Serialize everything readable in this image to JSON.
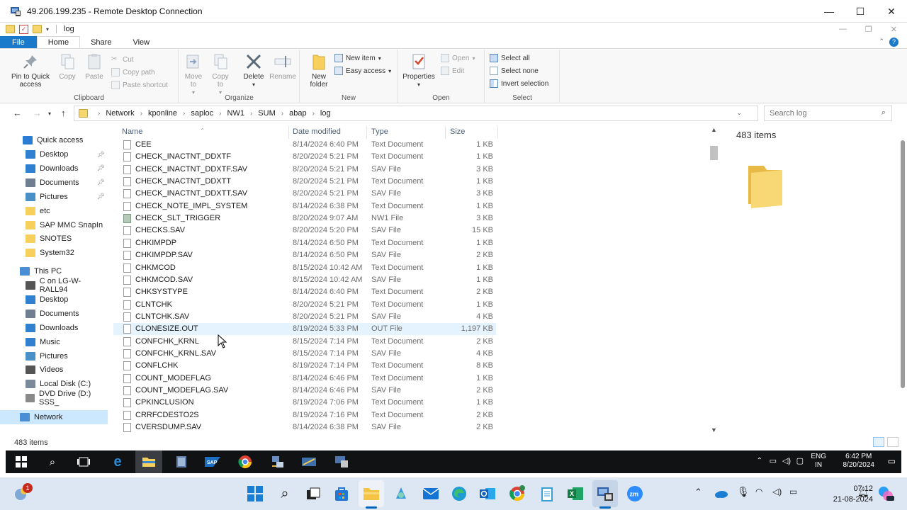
{
  "window": {
    "title": "49.206.199.235 - Remote Desktop Connection",
    "minimize": "—",
    "maximize": "☐",
    "close": "✕"
  },
  "explorer": {
    "title": "log",
    "tabs": [
      {
        "label": "File"
      },
      {
        "label": "Home"
      },
      {
        "label": "Share"
      },
      {
        "label": "View"
      }
    ],
    "help": "?"
  },
  "ribbon": {
    "clipboard": {
      "pin_label": "Pin to Quick access",
      "copy_label": "Copy",
      "paste_label": "Paste",
      "cut_label": "Cut",
      "copy_path_label": "Copy path",
      "paste_shortcut_label": "Paste shortcut",
      "group_label": "Clipboard"
    },
    "organize": {
      "move_to_label": "Move to",
      "copy_to_label": "Copy to",
      "delete_label": "Delete",
      "rename_label": "Rename",
      "group_label": "Organize"
    },
    "new": {
      "new_folder_label": "New folder",
      "new_item_label": "New item",
      "easy_access_label": "Easy access",
      "group_label": "New"
    },
    "open": {
      "properties_label": "Properties",
      "open_label": "Open",
      "edit_label": "Edit",
      "group_label": "Open"
    },
    "select": {
      "select_all_label": "Select all",
      "select_none_label": "Select none",
      "invert_label": "Invert selection",
      "group_label": "Select"
    }
  },
  "address": {
    "crumbs": [
      "Network",
      "kponline",
      "saploc",
      "NW1",
      "SUM",
      "abap",
      "log"
    ],
    "search_placeholder": "Search log"
  },
  "nav": {
    "quick_access": "Quick access",
    "qa_items": [
      "Desktop",
      "Downloads",
      "Documents",
      "Pictures",
      "etc",
      "SAP MMC SnapIn",
      "SNOTES",
      "System32"
    ],
    "this_pc": "This PC",
    "pc_items": [
      "C on LG-W-RALL94",
      "Desktop",
      "Documents",
      "Downloads",
      "Music",
      "Pictures",
      "Videos",
      "Local Disk (C:)",
      "DVD Drive (D:) SSS_"
    ],
    "network": "Network"
  },
  "columns": {
    "name": "Name",
    "date": "Date modified",
    "type": "Type",
    "size": "Size"
  },
  "files": [
    {
      "name": "CEE",
      "date": "8/14/2024 6:40 PM",
      "type": "Text Document",
      "size": "1 KB"
    },
    {
      "name": "CHECK_INACTNT_DDXTF",
      "date": "8/20/2024 5:21 PM",
      "type": "Text Document",
      "size": "1 KB"
    },
    {
      "name": "CHECK_INACTNT_DDXTF.SAV",
      "date": "8/20/2024 5:21 PM",
      "type": "SAV File",
      "size": "3 KB"
    },
    {
      "name": "CHECK_INACTNT_DDXTT",
      "date": "8/20/2024 5:21 PM",
      "type": "Text Document",
      "size": "1 KB"
    },
    {
      "name": "CHECK_INACTNT_DDXTT.SAV",
      "date": "8/20/2024 5:21 PM",
      "type": "SAV File",
      "size": "3 KB"
    },
    {
      "name": "CHECK_NOTE_IMPL_SYSTEM",
      "date": "8/14/2024 6:38 PM",
      "type": "Text Document",
      "size": "1 KB"
    },
    {
      "name": "CHECK_SLT_TRIGGER",
      "date": "8/20/2024 9:07 AM",
      "type": "NW1 File",
      "size": "3 KB"
    },
    {
      "name": "CHECKS.SAV",
      "date": "8/20/2024 5:20 PM",
      "type": "SAV File",
      "size": "15 KB"
    },
    {
      "name": "CHKIMPDP",
      "date": "8/14/2024 6:50 PM",
      "type": "Text Document",
      "size": "1 KB"
    },
    {
      "name": "CHKIMPDP.SAV",
      "date": "8/14/2024 6:50 PM",
      "type": "SAV File",
      "size": "2 KB"
    },
    {
      "name": "CHKMCOD",
      "date": "8/15/2024 10:42 AM",
      "type": "Text Document",
      "size": "1 KB"
    },
    {
      "name": "CHKMCOD.SAV",
      "date": "8/15/2024 10:42 AM",
      "type": "SAV File",
      "size": "1 KB"
    },
    {
      "name": "CHKSYSTYPE",
      "date": "8/14/2024 6:40 PM",
      "type": "Text Document",
      "size": "2 KB"
    },
    {
      "name": "CLNTCHK",
      "date": "8/20/2024 5:21 PM",
      "type": "Text Document",
      "size": "1 KB"
    },
    {
      "name": "CLNTCHK.SAV",
      "date": "8/20/2024 5:21 PM",
      "type": "SAV File",
      "size": "4 KB"
    },
    {
      "name": "CLONESIZE.OUT",
      "date": "8/19/2024 5:33 PM",
      "type": "OUT File",
      "size": "1,197 KB"
    },
    {
      "name": "CONFCHK_KRNL",
      "date": "8/15/2024 7:14 PM",
      "type": "Text Document",
      "size": "2 KB"
    },
    {
      "name": "CONFCHK_KRNL.SAV",
      "date": "8/15/2024 7:14 PM",
      "type": "SAV File",
      "size": "4 KB"
    },
    {
      "name": "CONFLCHK",
      "date": "8/19/2024 7:14 PM",
      "type": "Text Document",
      "size": "8 KB"
    },
    {
      "name": "COUNT_MODEFLAG",
      "date": "8/14/2024 6:46 PM",
      "type": "Text Document",
      "size": "1 KB"
    },
    {
      "name": "COUNT_MODEFLAG.SAV",
      "date": "8/14/2024 6:46 PM",
      "type": "SAV File",
      "size": "2 KB"
    },
    {
      "name": "CPKINCLUSION",
      "date": "8/19/2024 7:06 PM",
      "type": "Text Document",
      "size": "1 KB"
    },
    {
      "name": "CRRFCDESTO2S",
      "date": "8/19/2024 7:16 PM",
      "type": "Text Document",
      "size": "2 KB"
    },
    {
      "name": "CVERSDUMP.SAV",
      "date": "8/14/2024 6:38 PM",
      "type": "SAV File",
      "size": "2 KB"
    }
  ],
  "preview": {
    "count": "483 items"
  },
  "status": {
    "count": "483 items"
  },
  "remote_tray": {
    "lang1": "ENG",
    "lang2": "IN",
    "time": "6:42 PM",
    "date": "8/20/2024"
  },
  "local_tray": {
    "time": "07:12",
    "date": "21-08-2024",
    "badge": "1"
  },
  "colors": {
    "file_tab": "#1979ca",
    "selection": "#cce8ff",
    "folder": "#f6cf5c"
  }
}
